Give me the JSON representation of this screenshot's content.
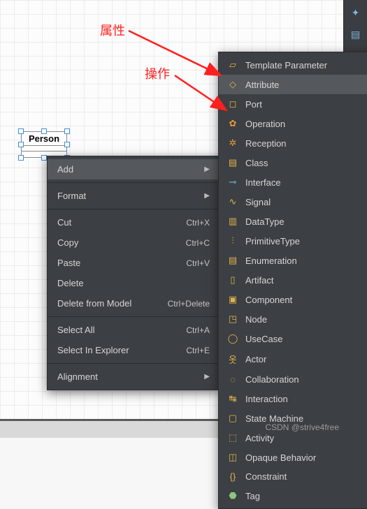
{
  "annotations": {
    "attribute_label": "属性",
    "operation_label": "操作"
  },
  "element": {
    "name": "Person"
  },
  "context_menu": {
    "add": "Add",
    "format": "Format",
    "cut": "Cut",
    "cut_sc": "Ctrl+X",
    "copy": "Copy",
    "copy_sc": "Ctrl+C",
    "paste": "Paste",
    "paste_sc": "Ctrl+V",
    "delete": "Delete",
    "delete_model": "Delete from Model",
    "delete_model_sc": "Ctrl+Delete",
    "select_all": "Select All",
    "select_all_sc": "Ctrl+A",
    "select_explorer": "Select In Explorer",
    "select_explorer_sc": "Ctrl+E",
    "alignment": "Alignment"
  },
  "add_submenu": {
    "template_parameter": "Template Parameter",
    "attribute": "Attribute",
    "port": "Port",
    "operation": "Operation",
    "reception": "Reception",
    "class": "Class",
    "interface": "Interface",
    "signal": "Signal",
    "datatype": "DataType",
    "primitive": "PrimitiveType",
    "enumeration": "Enumeration",
    "artifact": "Artifact",
    "component": "Component",
    "node": "Node",
    "usecase": "UseCase",
    "actor": "Actor",
    "collaboration": "Collaboration",
    "interaction": "Interaction",
    "state_machine": "State Machine",
    "activity": "Activity",
    "opaque_behavior": "Opaque Behavior",
    "constraint": "Constraint",
    "tag": "Tag"
  },
  "watermark": "CSDN @strive4free"
}
